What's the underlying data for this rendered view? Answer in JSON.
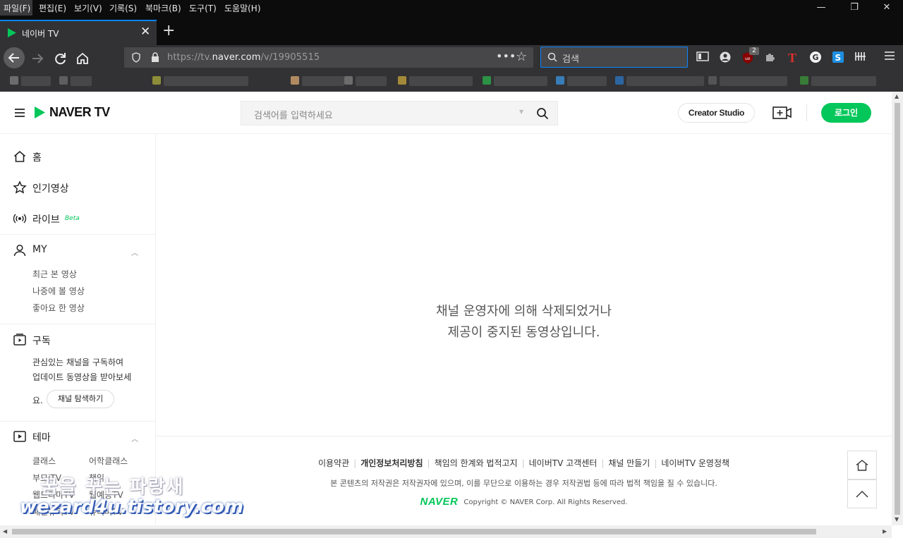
{
  "browser": {
    "menu": [
      "파일(F)",
      "편집(E)",
      "보기(V)",
      "기록(S)",
      "북마크(B)",
      "도구(T)",
      "도움말(H)"
    ],
    "tab_title": "네이버 TV",
    "url_prefix": "https://tv.",
    "url_domain": "naver.com",
    "url_path": "/v/19905515",
    "search_placeholder": "검색",
    "ublock_badge": "2"
  },
  "header": {
    "logo_text": "NAVER TV",
    "search_placeholder": "검색어를 입력하세요",
    "creator_studio": "Creator Studio",
    "login": "로그인"
  },
  "sidebar": {
    "home": "홈",
    "popular": "인기영상",
    "live": "라이브",
    "live_badge": "Beta",
    "my": "MY",
    "my_items": [
      "최근 본 영상",
      "나중에 볼 영상",
      "좋아요 한 영상"
    ],
    "subscribe": "구독",
    "subscribe_desc_1": "관심있는 채널을 구독하여",
    "subscribe_desc_2": "업데이트 동영상을 받아보세",
    "subscribe_desc_3": "요.",
    "explore_channels": "채널 탐색하기",
    "theme": "테마",
    "theme_items": [
      "클래스",
      "어학클래스",
      "부모iTV",
      "책읽",
      "웹드라마TV",
      "웹예능TV",
      "패션뷰티TV",
      "쥬니버TV"
    ]
  },
  "main": {
    "message_line1": "채널 운영자에 의해 삭제되었거나",
    "message_line2": "제공이 중지된 동영상입니다."
  },
  "footer": {
    "links": [
      "이용약관",
      "개인정보처리방침",
      "책임의 한계와 법적고지",
      "네이버TV 고객센터",
      "채널 만들기",
      "네이버TV 운영정책"
    ],
    "note": "본 콘텐츠의 저작권은 저작권자에 있으며, 이를 무단으로 이용하는 경우 저작권법 등에 따라 법적 책임을 질 수 있습니다.",
    "brand": "NAVER",
    "copyright": "Copyright © NAVER Corp. All Rights Reserved."
  },
  "watermark": {
    "line1": "꿈을 꾸는 파랑새",
    "line2": "wezard4u.tistory.com"
  },
  "colors": {
    "naver_green": "#03c75a",
    "chrome_dark": "#0c0c0d",
    "chrome_toolbar": "#323234",
    "focus_blue": "#0a84ff"
  }
}
